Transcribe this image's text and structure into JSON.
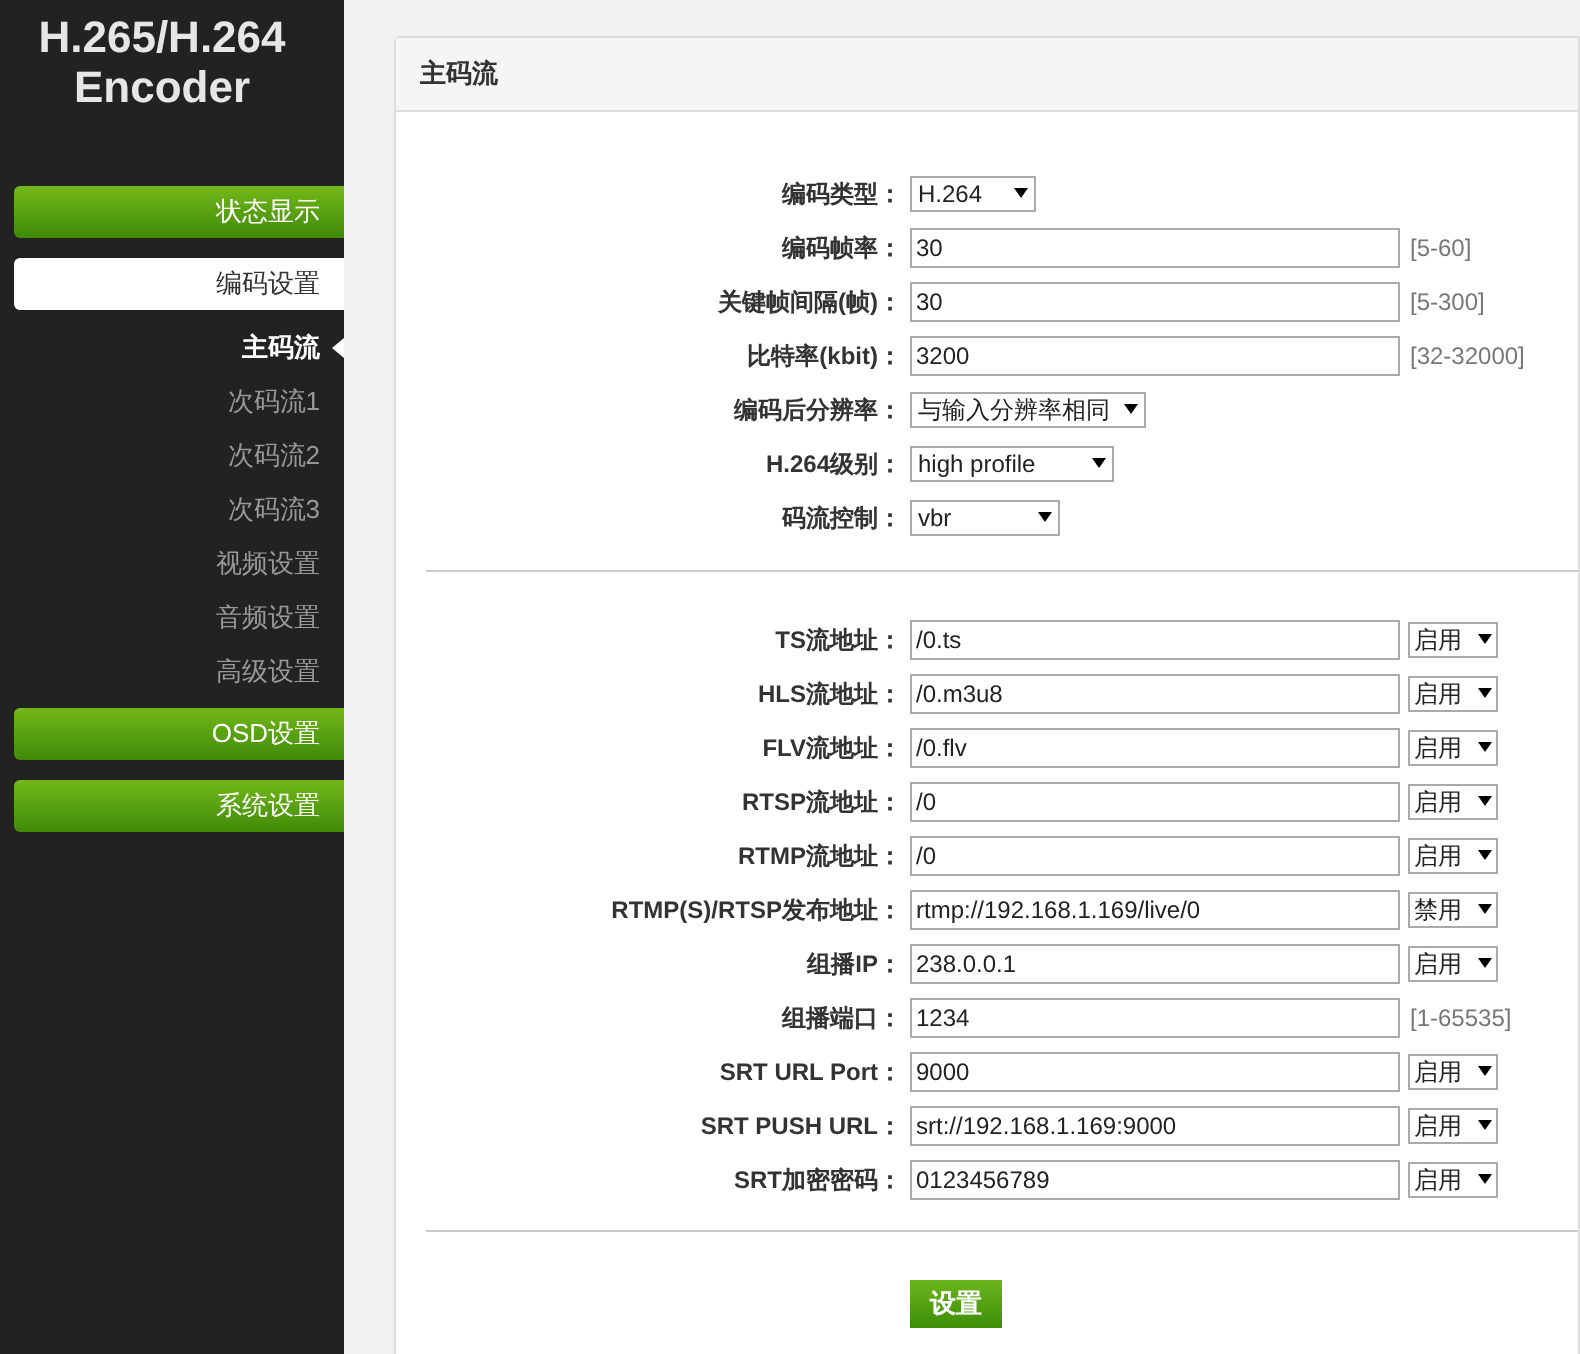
{
  "logo": {
    "line1": "H.265/H.264",
    "line2": "Encoder"
  },
  "sidebar": {
    "items": [
      {
        "label": "状态显示",
        "kind": "group",
        "selected": false
      },
      {
        "label": "编码设置",
        "kind": "group",
        "selected": true
      },
      {
        "label": "主码流",
        "kind": "sub",
        "selected": true
      },
      {
        "label": "次码流1",
        "kind": "sub",
        "selected": false
      },
      {
        "label": "次码流2",
        "kind": "sub",
        "selected": false
      },
      {
        "label": "次码流3",
        "kind": "sub",
        "selected": false
      },
      {
        "label": "视频设置",
        "kind": "sub",
        "selected": false
      },
      {
        "label": "音频设置",
        "kind": "sub",
        "selected": false
      },
      {
        "label": "高级设置",
        "kind": "sub",
        "selected": false
      },
      {
        "label": "OSD设置",
        "kind": "group",
        "selected": false
      },
      {
        "label": "系统设置",
        "kind": "group",
        "selected": false
      }
    ]
  },
  "panel": {
    "title": "主码流",
    "sections": [
      {
        "fields": [
          {
            "label": "编码类型：",
            "kind": "select",
            "value": "H.264"
          },
          {
            "label": "编码帧率：",
            "kind": "input",
            "value": "30",
            "hint": "[5-60]"
          },
          {
            "label": "关键帧间隔(帧)：",
            "kind": "input",
            "value": "30",
            "hint": "[5-300]"
          },
          {
            "label": "比特率(kbit)：",
            "kind": "input",
            "value": "3200",
            "hint": "[32-32000]"
          },
          {
            "label": "编码后分辨率：",
            "kind": "select",
            "value": "与输入分辨率相同"
          },
          {
            "label": "H.264级别：",
            "kind": "select",
            "value": "high profile"
          },
          {
            "label": "码流控制：",
            "kind": "select",
            "value": "vbr"
          }
        ]
      },
      {
        "fields": [
          {
            "label": "TS流地址：",
            "kind": "input",
            "value": "/0.ts",
            "toggle": "启用"
          },
          {
            "label": "HLS流地址：",
            "kind": "input",
            "value": "/0.m3u8",
            "toggle": "启用"
          },
          {
            "label": "FLV流地址：",
            "kind": "input",
            "value": "/0.flv",
            "toggle": "启用"
          },
          {
            "label": "RTSP流地址：",
            "kind": "input",
            "value": "/0",
            "toggle": "启用"
          },
          {
            "label": "RTMP流地址：",
            "kind": "input",
            "value": "/0",
            "toggle": "启用"
          },
          {
            "label": "RTMP(S)/RTSP发布地址：",
            "kind": "input",
            "value": "rtmp://192.168.1.169/live/0",
            "toggle": "禁用"
          },
          {
            "label": "组播IP：",
            "kind": "input",
            "value": "238.0.0.1",
            "toggle": "启用"
          },
          {
            "label": "组播端口：",
            "kind": "input",
            "value": "1234",
            "hint": "[1-65535]"
          },
          {
            "label": "SRT URL Port：",
            "kind": "input",
            "value": "9000",
            "toggle": "启用"
          },
          {
            "label": "SRT PUSH URL：",
            "kind": "input",
            "value": "srt://192.168.1.169:9000",
            "toggle": "启用"
          },
          {
            "label": "SRT加密密码：",
            "kind": "input",
            "value": "0123456789",
            "toggle": "启用"
          }
        ]
      }
    ],
    "submit": "设置"
  }
}
